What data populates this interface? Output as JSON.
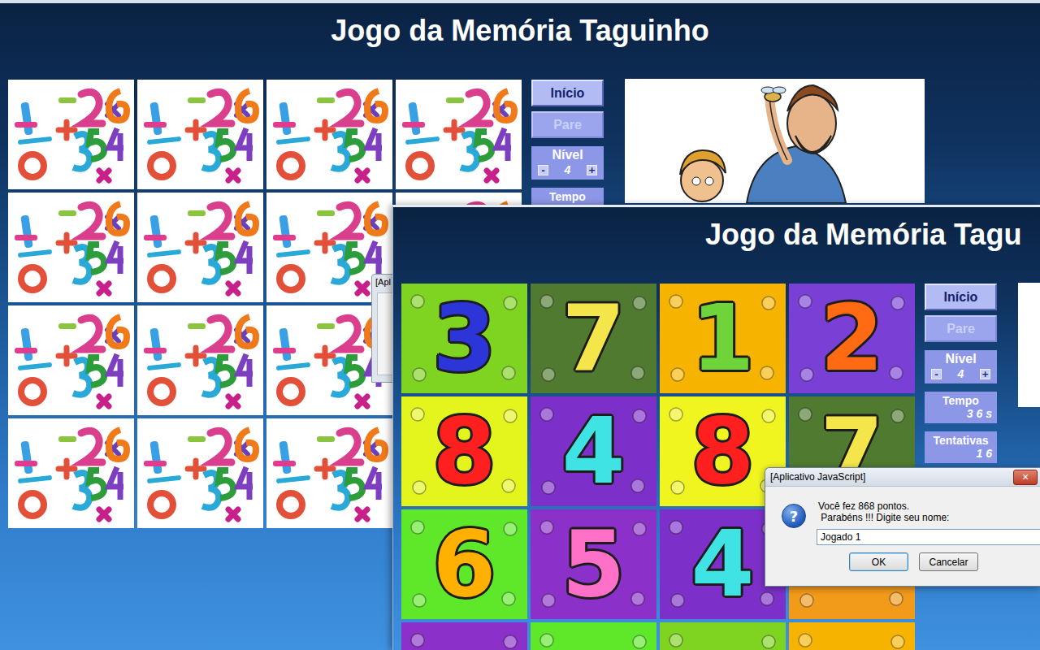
{
  "back_window": {
    "title": "Jogo da Memória Taguinho",
    "cards": [
      {
        "face_up": false
      },
      {
        "face_up": false
      },
      {
        "face_up": false
      },
      {
        "face_up": false
      },
      {
        "face_up": false
      },
      {
        "face_up": false
      },
      {
        "face_up": false
      },
      {
        "face_up": false
      },
      {
        "face_up": false
      },
      {
        "face_up": false
      },
      {
        "face_up": false
      },
      {
        "face_up": false
      },
      {
        "face_up": false
      },
      {
        "face_up": false
      },
      {
        "face_up": false
      },
      {
        "face_up": false
      }
    ],
    "panel": {
      "buttons": [
        {
          "label": "Início",
          "disabled": false
        },
        {
          "label": "Pare",
          "disabled": true
        }
      ],
      "level": {
        "label": "Nível",
        "minus": "-",
        "value": "4",
        "plus": "+"
      },
      "time": {
        "label": "Tempo"
      }
    },
    "dialog_fragment": {
      "title": "[Apl"
    }
  },
  "front_window": {
    "title": "Jogo da Memória Tagu",
    "cards": [
      {
        "face_up": true,
        "digit": "3",
        "color": "#7fd321",
        "ink": "#2b35d8"
      },
      {
        "face_up": true,
        "digit": "7",
        "color": "#4f7a2f",
        "ink": "#f4e64a"
      },
      {
        "face_up": true,
        "digit": "1",
        "color": "#f6b400",
        "ink": "#6fd43a"
      },
      {
        "face_up": true,
        "digit": "2",
        "color": "#7a40d6",
        "ink": "#ff6a12"
      },
      {
        "face_up": true,
        "digit": "8",
        "color": "#e4f51e",
        "ink": "#ff1f1f"
      },
      {
        "face_up": true,
        "digit": "4",
        "color": "#7d30c9",
        "ink": "#40e3e3"
      },
      {
        "face_up": true,
        "digit": "8",
        "color": "#f0f520",
        "ink": "#ff1f1f"
      },
      {
        "face_up": true,
        "digit": "7",
        "color": "#4f7a2f",
        "ink": "#f4e64a"
      },
      {
        "face_up": true,
        "digit": "6",
        "color": "#5fe82a",
        "ink": "#ffb000"
      },
      {
        "face_up": true,
        "digit": "5",
        "color": "#8b30c9",
        "ink": "#ff70c8"
      },
      {
        "face_up": true,
        "digit": "4",
        "color": "#7d30c9",
        "ink": "#40e3e3"
      },
      {
        "face_up": true,
        "color": "#f29a1a"
      },
      {
        "face_up": true,
        "color": "#8b30c9"
      },
      {
        "face_up": true,
        "color": "#5fe82a"
      },
      {
        "face_up": true,
        "color": "#7fd321"
      },
      {
        "face_up": true,
        "color": "#f6b400"
      }
    ],
    "panel": {
      "buttons": [
        {
          "label": "Início",
          "disabled": false
        },
        {
          "label": "Pare",
          "disabled": true
        }
      ],
      "level": {
        "label": "Nível",
        "minus": "-",
        "value": "4",
        "plus": "+"
      },
      "time": {
        "label": "Tempo",
        "value": "3 6 s"
      },
      "attempts": {
        "label": "Tentativas",
        "value": "1 6"
      }
    }
  },
  "dialog": {
    "title": "[Aplicativo JavaScript]",
    "close": "✕",
    "icon": "?",
    "message": [
      "Você fez 868 pontos.",
      " Parabéns !!! Digite seu nome:"
    ],
    "input": {
      "value": "Jogado 1"
    },
    "buttons": [
      {
        "label": "OK",
        "default": true
      },
      {
        "label": "Cancelar",
        "default": false
      }
    ]
  }
}
